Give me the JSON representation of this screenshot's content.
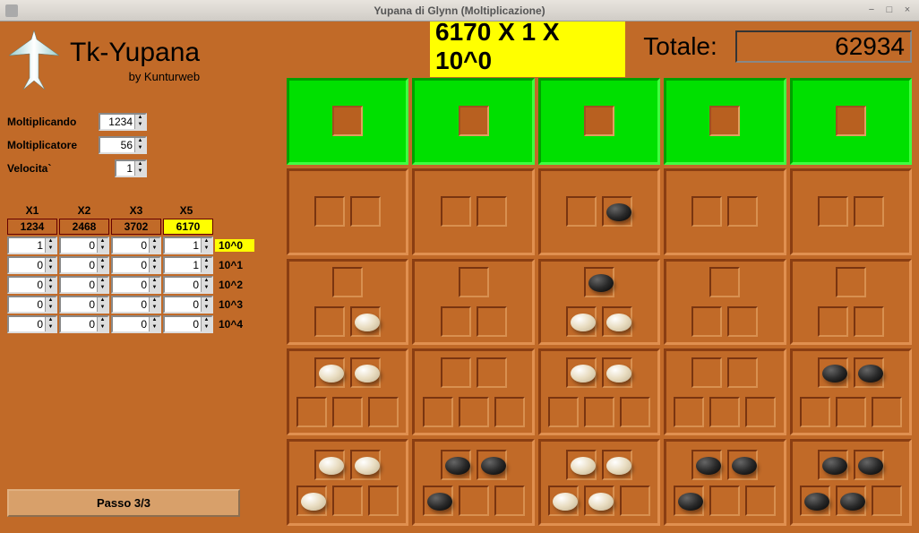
{
  "window": {
    "title": "Yupana di Glynn (Moltiplicazione)"
  },
  "logo": {
    "name": "Tk-Yupana",
    "byline": "by Kunturweb"
  },
  "params": {
    "multiplicand_label": "Moltiplicando",
    "multiplicand": "1234",
    "multiplier_label": "Moltiplicatore",
    "multiplier": "56",
    "speed_label": "Velocita`",
    "speed": "1"
  },
  "mult_table": {
    "headers": [
      "X1",
      "X2",
      "X3",
      "X5"
    ],
    "multiples": [
      "1234",
      "2468",
      "3702",
      "6170"
    ],
    "highlight_col": 3,
    "rows": [
      {
        "label": "10^0",
        "values": [
          "1",
          "0",
          "0",
          "1"
        ],
        "highlight_label": true
      },
      {
        "label": "10^1",
        "values": [
          "0",
          "0",
          "0",
          "1"
        ]
      },
      {
        "label": "10^2",
        "values": [
          "0",
          "0",
          "0",
          "0"
        ]
      },
      {
        "label": "10^3",
        "values": [
          "0",
          "0",
          "0",
          "0"
        ]
      },
      {
        "label": "10^4",
        "values": [
          "0",
          "0",
          "0",
          "0"
        ]
      }
    ]
  },
  "step_button": "Passo 3/3",
  "expression": "6170 X 1 X 10^0",
  "total_label": "Totale:",
  "total": "62934",
  "board": {
    "rows": 5,
    "cols": 5,
    "row_slots": [
      1,
      2,
      3,
      5,
      5
    ],
    "beans": {
      "1-2": [
        "",
        "black"
      ],
      "2-2": [
        "black",
        "",
        ""
      ],
      "2-0": [
        "",
        "",
        "white"
      ],
      "2-2b": [
        "",
        "white",
        "white"
      ],
      "3-0": [
        "white",
        "white",
        "",
        "",
        ""
      ],
      "3-2": [
        "white",
        "white",
        "",
        "",
        ""
      ],
      "3-4": [
        "black",
        "black",
        "",
        "",
        ""
      ],
      "4-0": [
        "white",
        "white",
        "white",
        "",
        ""
      ],
      "4-1": [
        "black",
        "black",
        "black",
        "",
        ""
      ],
      "4-2": [
        "white",
        "white",
        "white",
        "white",
        ""
      ],
      "4-3": [
        "black",
        "black",
        "black",
        "",
        ""
      ],
      "4-4": [
        "black",
        "black",
        "black",
        "black",
        ""
      ]
    }
  }
}
